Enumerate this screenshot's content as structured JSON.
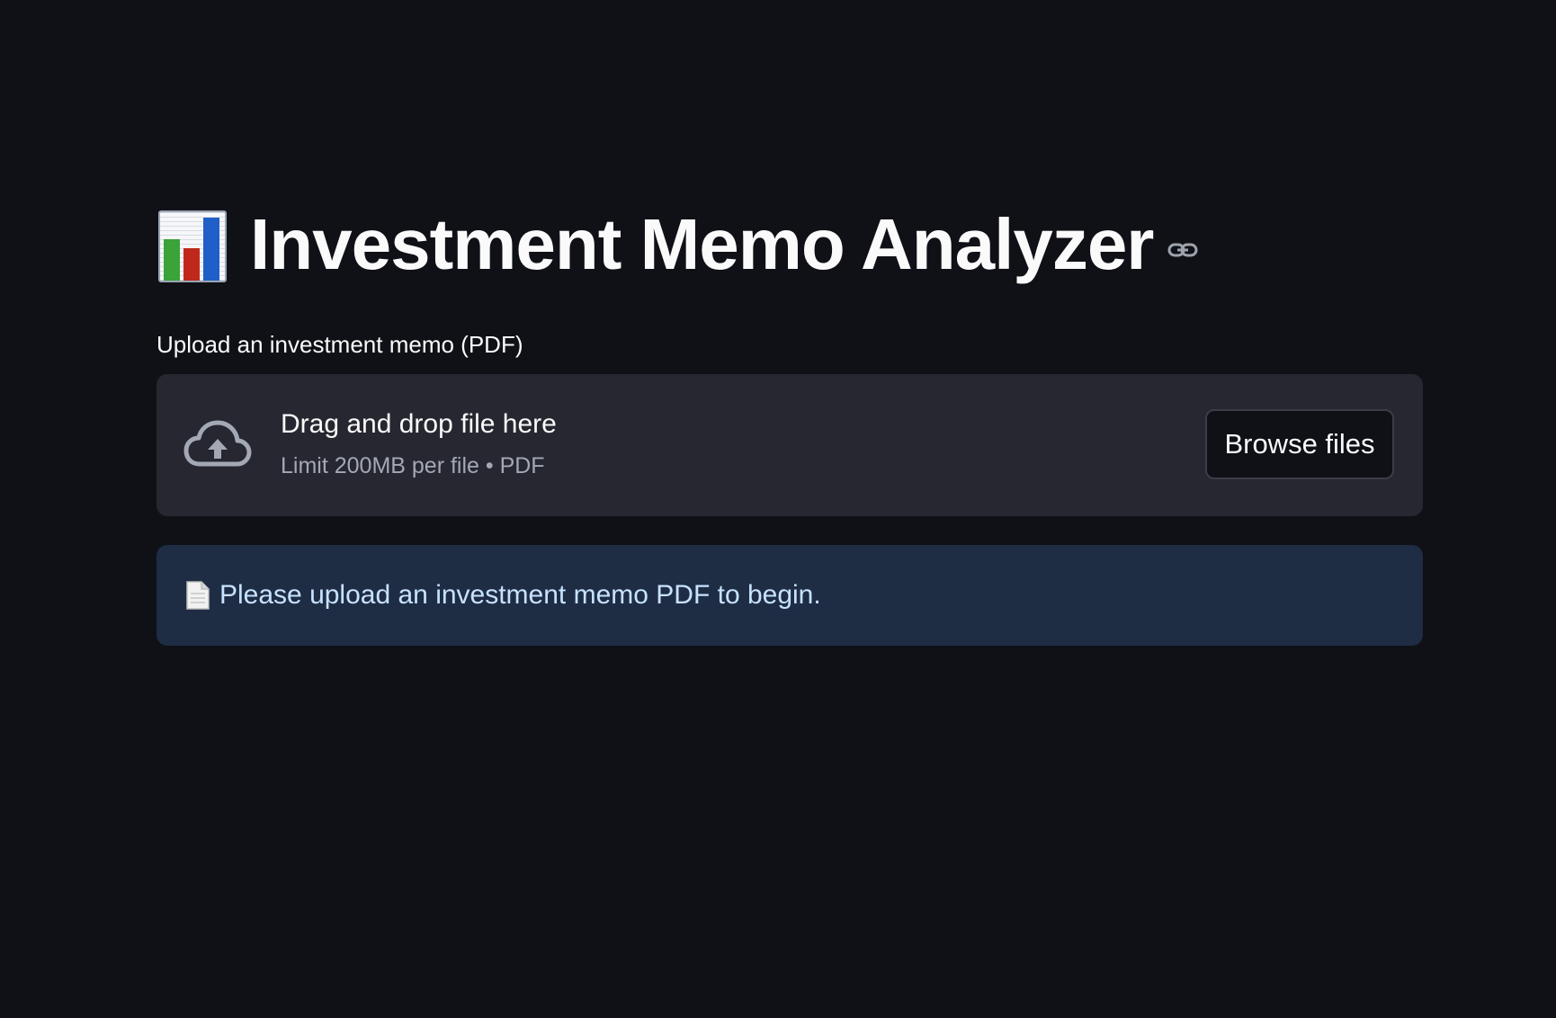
{
  "header": {
    "title_icon": "bar-chart-emoji",
    "title": "Investment Memo Analyzer",
    "anchor_icon": "link-icon"
  },
  "uploader": {
    "label": "Upload an investment memo (PDF)",
    "icon": "cloud-upload-icon",
    "drag_text": "Drag and drop file here",
    "limit_text": "Limit 200MB per file • PDF",
    "browse_label": "Browse files"
  },
  "info": {
    "icon": "page-facing-up-icon",
    "message": "Please upload an investment memo PDF to begin."
  },
  "colors": {
    "background": "#0f1117",
    "dropzone_bg": "#262730",
    "info_bg": "#1e2d44",
    "info_text": "#c7e2ff"
  }
}
